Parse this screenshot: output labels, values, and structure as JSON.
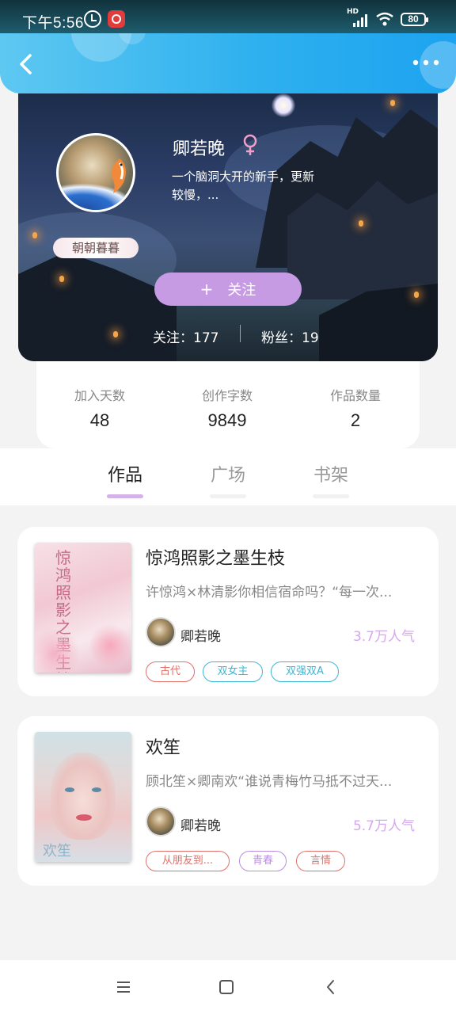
{
  "status_bar": {
    "time": "下午5:56",
    "network": "HD",
    "battery": "80"
  },
  "profile": {
    "nickname": "卿若晚",
    "bio": "一个脑洞大开的新手，更新较慢，...",
    "frame_label": "朝朝暮暮",
    "follow_button": "关注",
    "following": "关注：177",
    "followers": "粉丝：19",
    "gender_color": "#f2a0c8"
  },
  "stats": [
    {
      "label": "加入天数",
      "value": "48"
    },
    {
      "label": "创作字数",
      "value": "9849"
    },
    {
      "label": "作品数量",
      "value": "2"
    }
  ],
  "tabs": [
    {
      "label": "作品",
      "active": true
    },
    {
      "label": "广场",
      "active": false
    },
    {
      "label": "书架",
      "active": false
    }
  ],
  "works": [
    {
      "title": "惊鸿照影之墨生枝",
      "desc": "许惊鸿×林清影你相信宿命吗？“每一次...",
      "author": "卿若晚",
      "popularity": "3.7万人气",
      "cover_text": "惊鸿照影之墨生枝",
      "tags": [
        {
          "label": "古代",
          "color": "#e0706a"
        },
        {
          "label": "双女主",
          "color": "#3ab6d8"
        },
        {
          "label": "双强双A",
          "color": "#3ab6d8"
        }
      ]
    },
    {
      "title": "欢笙",
      "desc": "顾北笙×卿南欢“谁说青梅竹马抵不过天...",
      "author": "卿若晚",
      "popularity": "5.7万人气",
      "cover_text": "欢笙",
      "tags": [
        {
          "label": "从朋友到...",
          "color": "#e0706a"
        },
        {
          "label": "青春",
          "color": "#b98ee0"
        },
        {
          "label": "言情",
          "color": "#e0706a"
        }
      ]
    }
  ],
  "colors": {
    "accent": "#c79be3",
    "header": "#2fb1ef",
    "popularity": "#d3a8ef"
  }
}
